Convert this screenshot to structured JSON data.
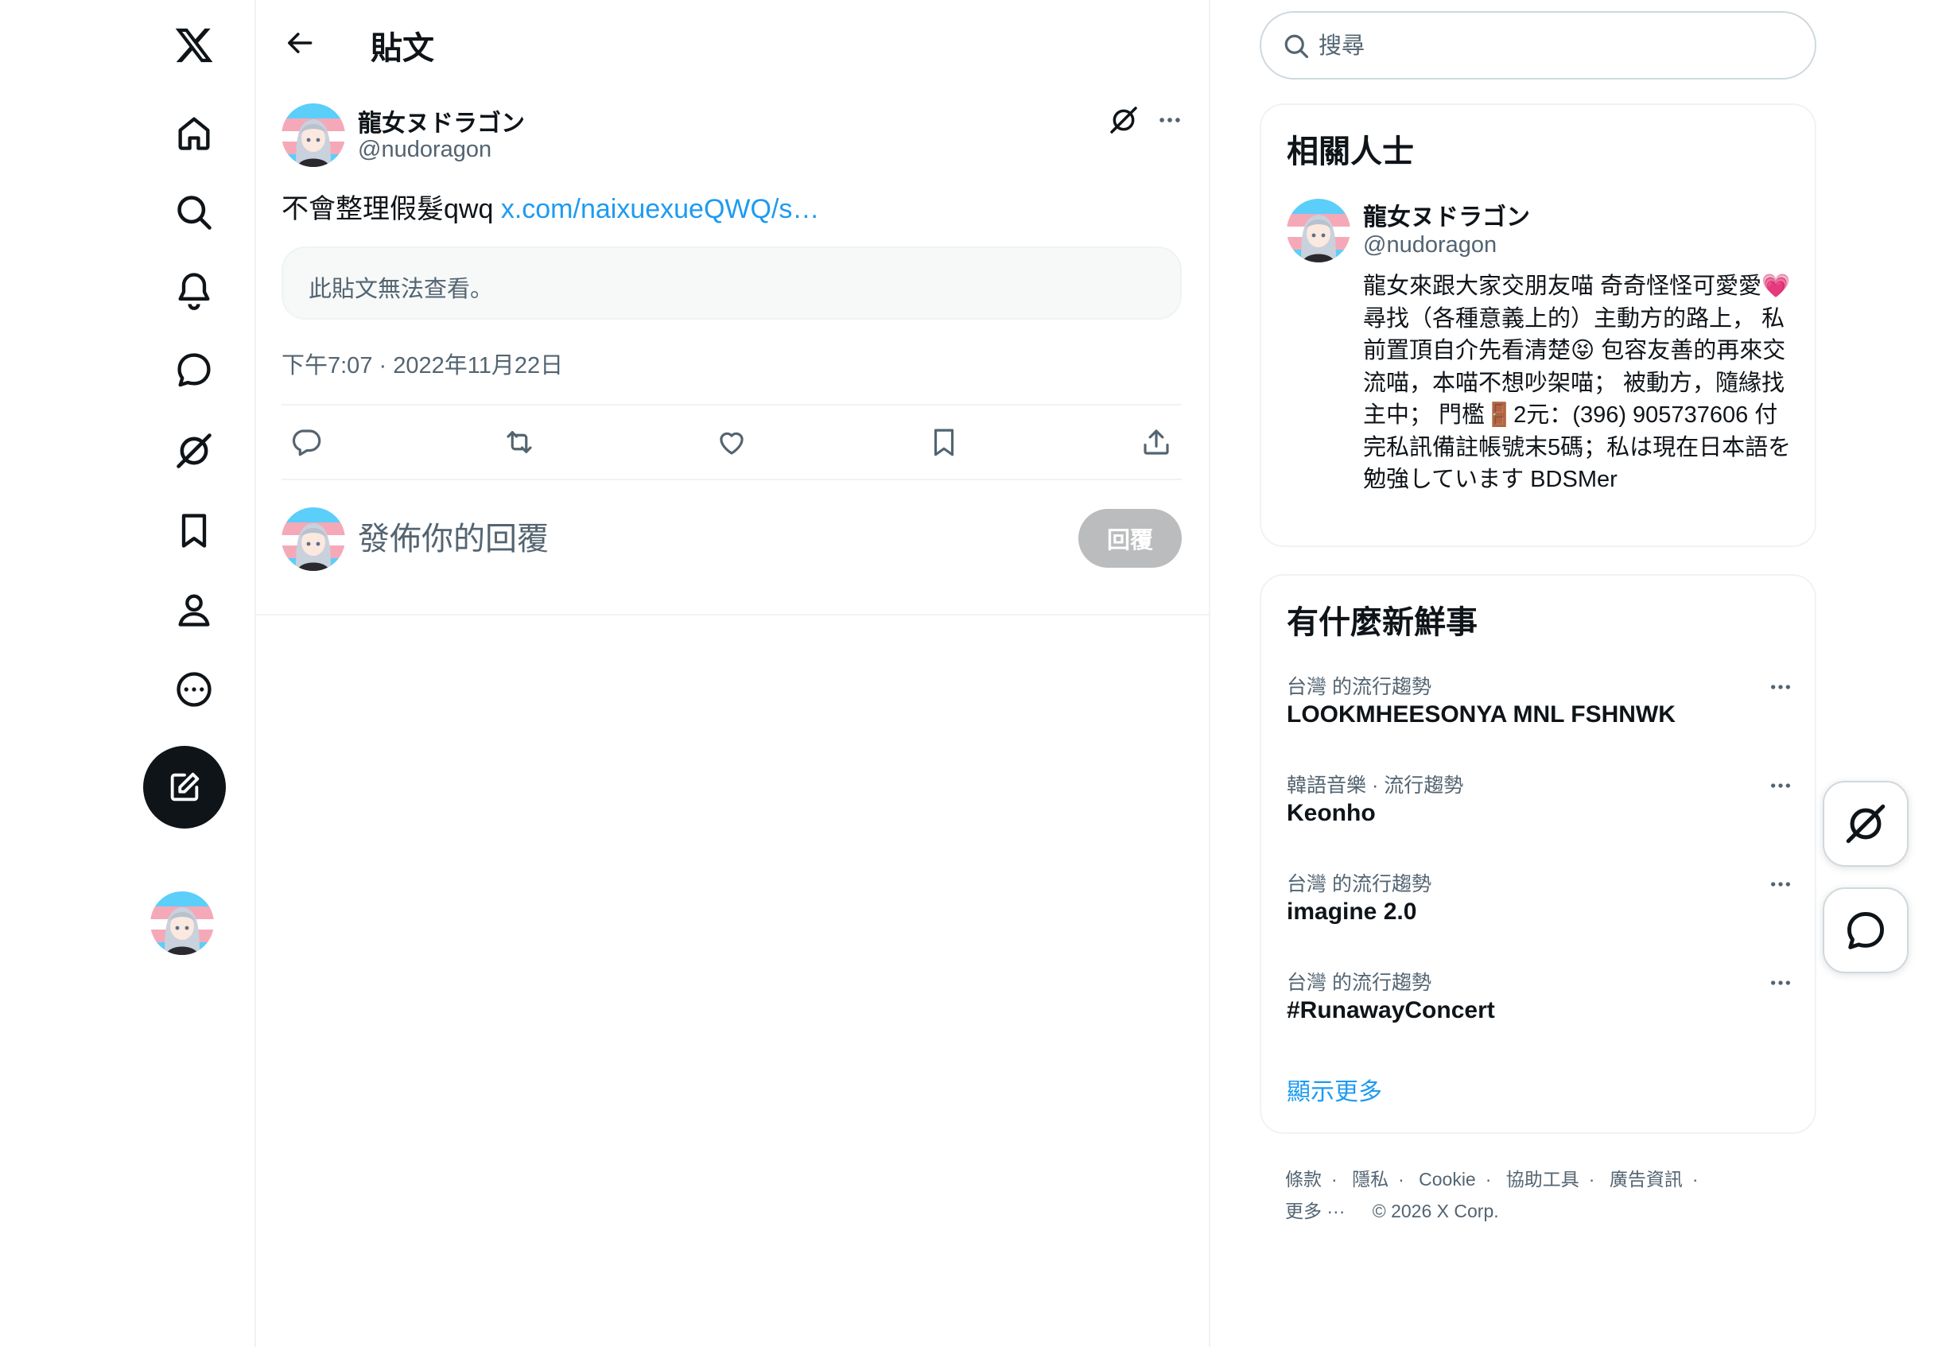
{
  "nav": {
    "items": [
      {
        "icon": "x-logo-icon"
      },
      {
        "icon": "home-icon"
      },
      {
        "icon": "search-icon"
      },
      {
        "icon": "notifications-icon"
      },
      {
        "icon": "messages-icon"
      },
      {
        "icon": "grok-icon"
      },
      {
        "icon": "bookmarks-icon"
      },
      {
        "icon": "profile-icon"
      },
      {
        "icon": "more-icon"
      }
    ],
    "compose_icon": "compose-icon"
  },
  "header": {
    "title": "貼文"
  },
  "post": {
    "author_name": "龍女ヌドラゴン",
    "author_handle": "@nudoragon",
    "text": "不會整理假髮qwq ",
    "link_text": "x.com/naixuexueQWQ/s…",
    "unavailable_text": "此貼文無法查看。",
    "timestamp": "下午7:07 · 2022年11月22日"
  },
  "reply": {
    "placeholder": "發佈你的回覆",
    "button_label": "回覆"
  },
  "search": {
    "placeholder": "搜尋"
  },
  "related": {
    "title": "相關人士",
    "name": "龍女ヌドラゴン",
    "handle": "@nudoragon",
    "bio": "龍女來跟大家交朋友喵 奇奇怪怪可愛愛💗 尋找（各種意義上的）主動方的路上， 私前置頂自介先看清楚😝 包容友善的再來交流喵，本喵不想吵架喵； 被動方，隨緣找主中； 門檻🚪2元：(396) 905737606 付完私訊備註帳號末5碼；私は現在日本語を勉強しています BDSMer"
  },
  "trends": {
    "title": "有什麼新鮮事",
    "items": [
      {
        "meta": "台灣 的流行趨勢",
        "name": "LOOKMHEESONYA MNL FSHNWK"
      },
      {
        "meta": "韓語音樂 · 流行趨勢",
        "name": "Keonho"
      },
      {
        "meta": "台灣 的流行趨勢",
        "name": "imagine 2.0"
      },
      {
        "meta": "台灣 的流行趨勢",
        "name": "#RunawayConcert"
      }
    ],
    "show_more": "顯示更多"
  },
  "footer": {
    "links": [
      "條款",
      "隱私",
      "Cookie",
      "協助工具",
      "廣告資訊"
    ],
    "more": "更多 ···",
    "copyright": "© 2026 X Corp."
  },
  "colors": {
    "accent": "#1d9bf0",
    "text": "#0f1419",
    "secondary": "#536471",
    "border": "#eff3f4"
  }
}
